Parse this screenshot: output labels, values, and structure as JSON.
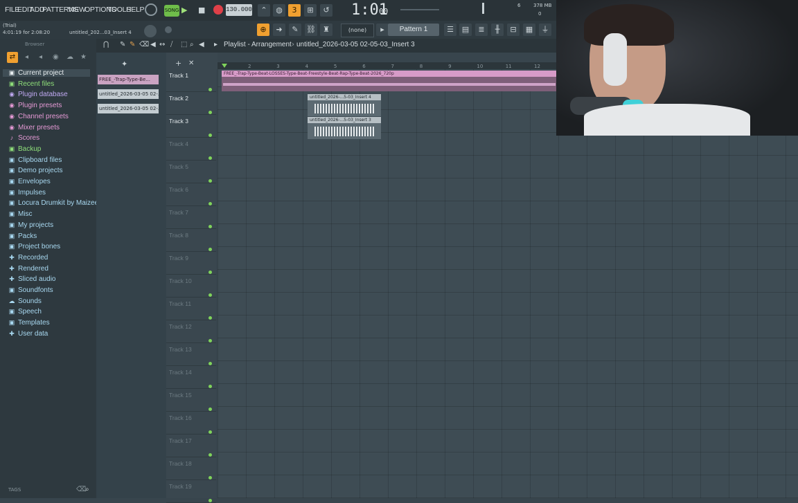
{
  "menu": [
    "FILE",
    "EDIT",
    "ADD",
    "PATTERNS",
    "VIEW",
    "OPTIONS",
    "TOOLS",
    "HELP"
  ],
  "transport": {
    "mode": "SONG",
    "tempo": "130.000",
    "time": "1:01",
    "time_sub": "00",
    "memory": "378 MB",
    "cpu_top": "6",
    "cpu_bottom": "0"
  },
  "info": {
    "trial": "(Trial)",
    "position": "4:01:19 for 2:08:20",
    "hint": "untitled_202...03_Insert 4",
    "snap": "(none)",
    "pattern": "Pattern 1"
  },
  "browser": {
    "title": "Browser",
    "tags": "TAGS",
    "items": [
      {
        "label": "Current project",
        "icon": "▣",
        "color": "#e8eef0"
      },
      {
        "label": "Recent files",
        "icon": "▣",
        "color": "#8fe07a"
      },
      {
        "label": "Plugin database",
        "icon": "◉",
        "color": "#c0a9f2"
      },
      {
        "label": "Plugin presets",
        "icon": "◉",
        "color": "#e69ad6"
      },
      {
        "label": "Channel presets",
        "icon": "◉",
        "color": "#e69ad6"
      },
      {
        "label": "Mixer presets",
        "icon": "◉",
        "color": "#e69ad6"
      },
      {
        "label": "Scores",
        "icon": "♪",
        "color": "#e69ad6"
      },
      {
        "label": "Backup",
        "icon": "▣",
        "color": "#8fe07a"
      },
      {
        "label": "Clipboard files",
        "icon": "▣",
        "color": "#a8d8f0"
      },
      {
        "label": "Demo projects",
        "icon": "▣",
        "color": "#a8d8f0"
      },
      {
        "label": "Envelopes",
        "icon": "▣",
        "color": "#a8d8f0"
      },
      {
        "label": "Impulses",
        "icon": "▣",
        "color": "#a8d8f0"
      },
      {
        "label": "Locura Drumkit by Maizeeno",
        "icon": "▣",
        "color": "#a8d8f0"
      },
      {
        "label": "Misc",
        "icon": "▣",
        "color": "#a8d8f0"
      },
      {
        "label": "My projects",
        "icon": "▣",
        "color": "#a8d8f0"
      },
      {
        "label": "Packs",
        "icon": "▣",
        "color": "#a8d8f0"
      },
      {
        "label": "Project bones",
        "icon": "▣",
        "color": "#a8d8f0"
      },
      {
        "label": "Recorded",
        "icon": "✚",
        "color": "#a8d8f0"
      },
      {
        "label": "Rendered",
        "icon": "✚",
        "color": "#a8d8f0"
      },
      {
        "label": "Sliced audio",
        "icon": "✚",
        "color": "#a8d8f0"
      },
      {
        "label": "Soundfonts",
        "icon": "▣",
        "color": "#a8d8f0"
      },
      {
        "label": "Sounds",
        "icon": "☁",
        "color": "#a8d8f0"
      },
      {
        "label": "Speech",
        "icon": "▣",
        "color": "#a8d8f0"
      },
      {
        "label": "Templates",
        "icon": "▣",
        "color": "#a8d8f0"
      },
      {
        "label": "User data",
        "icon": "✚",
        "color": "#a8d8f0"
      }
    ]
  },
  "picker": [
    "FREE_-Trap-Type-Be...",
    "untitled_2026-03-05 02-...",
    "untitled_2026-03-05 02-..."
  ],
  "playlist": {
    "title": "Playlist - Arrangement",
    "breadcrumb": "untitled_2026-03-05 02-05-03_Insert 3",
    "ruler": [
      "2",
      "3",
      "4",
      "5",
      "6",
      "7",
      "8",
      "9",
      "10",
      "11",
      "12"
    ],
    "tracks": [
      "Track 1",
      "Track 2",
      "Track 3",
      "Track 4",
      "Track 5",
      "Track 6",
      "Track 7",
      "Track 8",
      "Track 9",
      "Track 10",
      "Track 11",
      "Track 12",
      "Track 13",
      "Track 14",
      "Track 15",
      "Track 16",
      "Track 17",
      "Track 18",
      "Track 19"
    ],
    "clips": [
      {
        "label": "FREE_-Trap-Type-Beat-LOSSES-Type-Beat-Freestyle-Beat-Rap-Type-Beat-2026_720p",
        "color": "#d79bc8"
      },
      {
        "label": "untitled_2026-...5-03_Insert 4",
        "color": "#d9dde0"
      },
      {
        "label": "untitled_2026-...5-03_Insert 3",
        "color": "#d9dde0"
      }
    ]
  },
  "colors": {
    "accent": "#f0a030",
    "record": "#e04048",
    "track_dot": "#7fd35b"
  }
}
